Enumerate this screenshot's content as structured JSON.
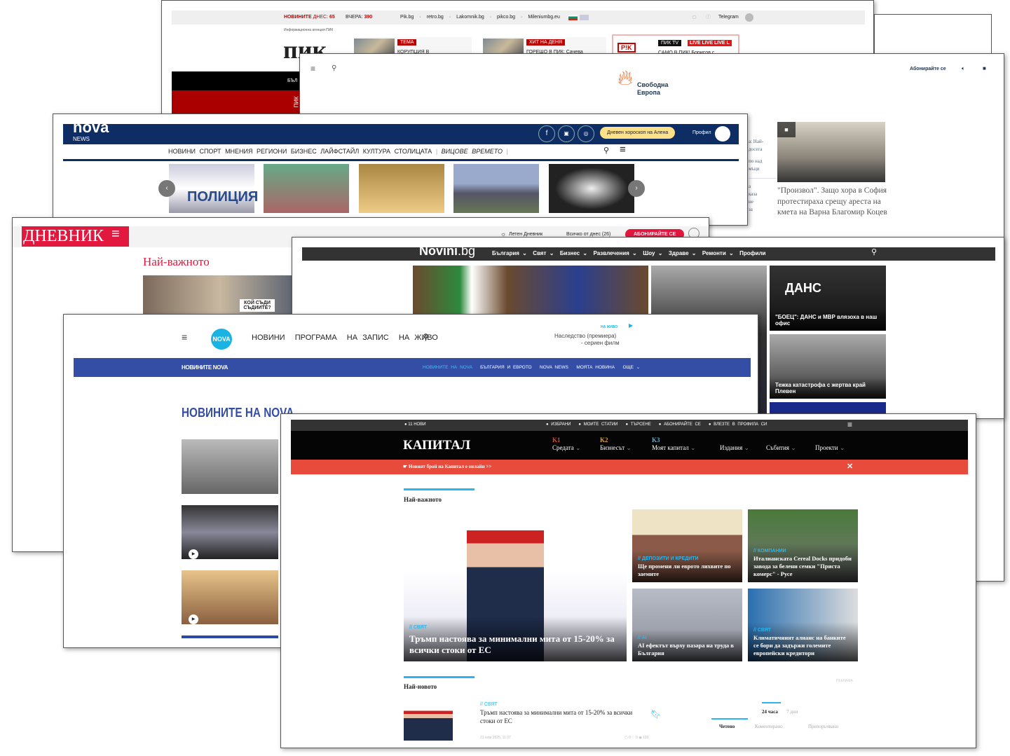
{
  "pik": {
    "news_today_label": "НОВИНИТЕ",
    "today_label": "ДНЕС:",
    "today_count": "65",
    "yesterday_label": "ВЧЕРА:",
    "yesterday_count": "390",
    "links": [
      "Pik.bg",
      "retro.bg",
      "Lakomnik.bg",
      "pikco.bg",
      "Mileniumbg.eu"
    ],
    "telegram": "Telegram",
    "agency": "Информационна агенция ПИК",
    "logo": "пик",
    "tag1": "ТЕМА",
    "head1": "КОРУПЦИЯ В",
    "tag2": "ХИТ НА ДЕНЯ",
    "head2": "ГОРЕЩО В ПИК: Сачева",
    "tv": "ПИК TV",
    "live": "LIVE LIVE LIVE L",
    "head3": "САМО В ПИК! Борисов с",
    "pik_badge": "P!K",
    "side_text": "БЪЛ",
    "vertical": "ПИК"
  },
  "svobodna": {
    "logo_line1": "Свободна",
    "logo_line2": "Европа",
    "subscribe": "Абонирайте се",
    "feature_title": "\"Произвол\". Защо хора в София протестираха срещу ареста на кмета на Варна Благомир Коцев",
    "side_snips": [
      "а: Най-",
      "досега",
      "по над",
      "мъци",
      "а",
      "каза",
      "не",
      "за"
    ]
  },
  "novanews": {
    "logo": "nova",
    "logo_sub": "NEWS",
    "horoscope": "Дневен хороскоп на Алена",
    "profile": "Профил",
    "nav": [
      "НОВИНИ",
      "СПОРТ",
      "МНЕНИЯ",
      "РЕГИОНИ",
      "БИЗНЕС",
      "ЛАЙФСТАЙЛ",
      "КУЛТУРА",
      "СТОЛИЦАТА"
    ],
    "nav_italic": [
      "ВИЦОВЕ",
      "ВРЕМЕТО"
    ],
    "thumb_text": "ПОЛИЦИЯ"
  },
  "dnevnik": {
    "logo": "ДНЕВНИК",
    "summer": "Летен Дневник",
    "all_today": "Всичко от днес (26)",
    "subscribe": "АБОНИРАЙТЕ СЕ",
    "section": "Най-важното",
    "sign": "КОЙ СЪДИ СЪДИИТЕ?"
  },
  "novini": {
    "logo": "Novini",
    "logo_tld": ".bg",
    "nav": [
      "България",
      "Свят",
      "Бизнес",
      "Развлечения",
      "Шоу",
      "Здраве",
      "Ремонти",
      "Профили"
    ],
    "card1_sign": "ДАНС",
    "card1": "\"БОЕЦ\": ДАНС и МВР влязоха в наш офис",
    "card2": "Тежка катастрофа с жертва край Плевен"
  },
  "nova": {
    "logo": "NOVA",
    "nav": [
      "НОВИНИ",
      "ПРОГРАМА",
      "НА ЗАПИС",
      "НА ЖИВО"
    ],
    "live_label": "НА ЖИВО",
    "live_show": "Наследство (премиера)",
    "live_show2": "- сериен филм",
    "bar_logo": "НОВИНИТЕ NOVA",
    "bar_nav": [
      "НОВИНИТЕ НА NOVA",
      "БЪЛГАРИЯ И ЕВРОТО",
      "NOVA NEWS",
      "МОЯТА НОВИНА",
      "ОЩЕ"
    ],
    "title": "НОВИНИТЕ НА NOVA",
    "accent": "#2b4aa8"
  },
  "kapital": {
    "top": [
      "11 НОВИ",
      "ИЗБРАНИ",
      "МОИТЕ СТАТИИ",
      "ТЪРСЕНЕ",
      "АБОНИРАЙТЕ СЕ",
      "ВЛЕЗТЕ В ПРОФИЛА СИ"
    ],
    "logo": "КАПИТАЛ",
    "menu": [
      {
        "k": "K1",
        "l": "Средата",
        "c": "#e2452f"
      },
      {
        "k": "K2",
        "l": "Бизнесът",
        "c": "#e2a22f"
      },
      {
        "k": "K3",
        "l": "Моят капитал",
        "c": "#6aa9c9"
      },
      {
        "k": "",
        "l": "Издания",
        "c": "#999"
      },
      {
        "k": "",
        "l": "Събития",
        "c": "#999"
      },
      {
        "k": "",
        "l": "Проекти",
        "c": "#999"
      }
    ],
    "banner": "Новият брой на Капитал е онлайн >>",
    "section1": "Най-важното",
    "main": {
      "cat": "// СВЯТ",
      "title": "Тръмп настоява за минимални мита от 15-20% за всички стоки от ЕС"
    },
    "cards": [
      {
        "cat": "// ДЕПОЗИТИ И КРЕДИТИ",
        "title": "Ще промени ли еврото лихвите по заемите"
      },
      {
        "cat": "// КОМПАНИИ",
        "title": "Италианската Cereal Docks придоби завода за белени семки \"Приста комерс\" - Русе"
      },
      {
        "cat": "// AI",
        "title": "AI ефектът върху пазара на труда в България"
      },
      {
        "cat": "// СВЯТ",
        "title": "Климатичният алианс на банките се бори да задържи големите европейски кредитори"
      }
    ],
    "section2": "Най-новото",
    "ad": "РЕКЛАМА",
    "latest": {
      "cat": "// СВЯТ",
      "title": "Тръмп настоява за минимални мита от 15-20% за всички стоки от ЕС",
      "date": "21 юли 2025, 11:37",
      "comments": "0",
      "likes": "0",
      "views": "193"
    },
    "tabs_period": [
      "24 часа",
      "7 дни"
    ],
    "tabs": [
      "Четено",
      "Коментирано",
      "Препоръчвано"
    ],
    "accent": "#2bb5ef",
    "banner_color": "#e84a3c"
  }
}
